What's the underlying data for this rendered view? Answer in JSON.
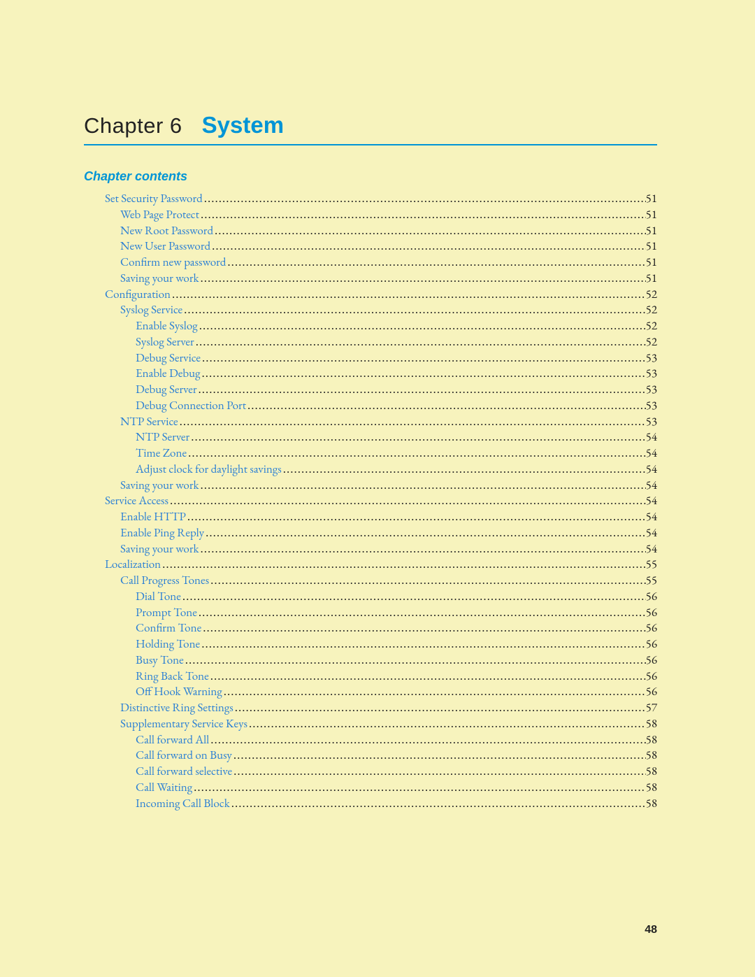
{
  "chapter": {
    "label": "Chapter 6",
    "title": "System"
  },
  "contents_heading": "Chapter contents",
  "page_number": "48",
  "toc": [
    {
      "level": 0,
      "label": "Set Security Password",
      "page": "51"
    },
    {
      "level": 1,
      "label": "Web Page Protect",
      "page": "51"
    },
    {
      "level": 1,
      "label": "New Root Password",
      "page": "51"
    },
    {
      "level": 1,
      "label": "New User Password",
      "page": "51"
    },
    {
      "level": 1,
      "label": "Confirm new password",
      "page": "51"
    },
    {
      "level": 1,
      "label": "Saving your work",
      "page": "51"
    },
    {
      "level": 0,
      "label": "Configuration",
      "page": "52"
    },
    {
      "level": 1,
      "label": "Syslog Service",
      "page": "52"
    },
    {
      "level": 2,
      "label": "Enable Syslog",
      "page": "52"
    },
    {
      "level": 2,
      "label": "Syslog Server",
      "page": "52"
    },
    {
      "level": 2,
      "label": "Debug Service",
      "page": "53"
    },
    {
      "level": 2,
      "label": "Enable Debug",
      "page": "53"
    },
    {
      "level": 2,
      "label": "Debug Server",
      "page": "53"
    },
    {
      "level": 2,
      "label": "Debug Connection Port",
      "page": "53"
    },
    {
      "level": 1,
      "label": "NTP Service",
      "page": "53"
    },
    {
      "level": 2,
      "label": "NTP Server",
      "page": "54"
    },
    {
      "level": 2,
      "label": "Time Zone",
      "page": "54"
    },
    {
      "level": 2,
      "label": "Adjust clock for daylight savings",
      "page": "54"
    },
    {
      "level": 1,
      "label": "Saving your work",
      "page": "54"
    },
    {
      "level": 0,
      "label": "Service Access",
      "page": "54"
    },
    {
      "level": 1,
      "label": "Enable HTTP",
      "page": "54"
    },
    {
      "level": 1,
      "label": "Enable Ping Reply",
      "page": "54"
    },
    {
      "level": 1,
      "label": "Saving your work",
      "page": "54"
    },
    {
      "level": 0,
      "label": "Localization",
      "page": "55"
    },
    {
      "level": 1,
      "label": "Call Progress Tones",
      "page": "55"
    },
    {
      "level": 2,
      "label": "Dial Tone",
      "page": "56"
    },
    {
      "level": 2,
      "label": "Prompt Tone",
      "page": "56"
    },
    {
      "level": 2,
      "label": "Confirm Tone",
      "page": "56"
    },
    {
      "level": 2,
      "label": "Holding Tone",
      "page": "56"
    },
    {
      "level": 2,
      "label": "Busy Tone",
      "page": "56"
    },
    {
      "level": 2,
      "label": "Ring Back Tone",
      "page": "56"
    },
    {
      "level": 2,
      "label": "Off Hook Warning",
      "page": "56"
    },
    {
      "level": 1,
      "label": "Distinctive Ring Settings",
      "page": "57"
    },
    {
      "level": 1,
      "label": "Supplementary Service Keys",
      "page": "58"
    },
    {
      "level": 2,
      "label": "Call forward All",
      "page": "58"
    },
    {
      "level": 2,
      "label": "Call forward on Busy",
      "page": "58"
    },
    {
      "level": 2,
      "label": "Call forward selective",
      "page": "58"
    },
    {
      "level": 2,
      "label": "Call Waiting",
      "page": "58"
    },
    {
      "level": 2,
      "label": "Incoming Call Block",
      "page": "58"
    }
  ]
}
